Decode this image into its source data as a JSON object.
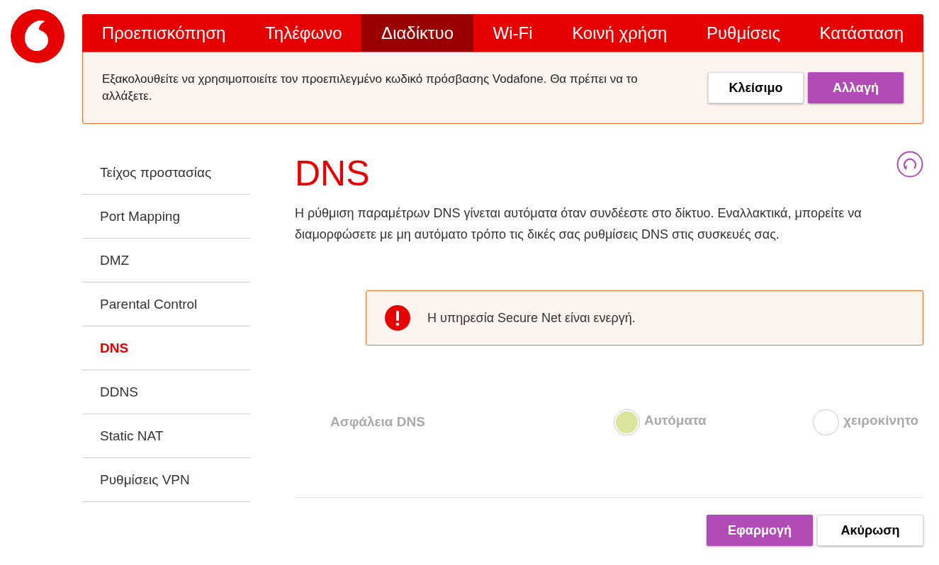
{
  "nav": [
    {
      "label": "Προεπισκόπηση",
      "selected": false
    },
    {
      "label": "Τηλέφωνο",
      "selected": false
    },
    {
      "label": "Διαδίκτυο",
      "selected": true
    },
    {
      "label": "Wi-Fi",
      "selected": false
    },
    {
      "label": "Κοινή χρήση",
      "selected": false
    },
    {
      "label": "Ρυθμίσεις",
      "selected": false
    },
    {
      "label": "Κατάσταση",
      "selected": false
    }
  ],
  "banner": {
    "text": "Εξακολουθείτε να χρησιμοποιείτε τον προεπιλεγμένο κωδικό πρόσβασης Vodafone. Θα πρέπει να το αλλάξετε.",
    "buttons": [
      {
        "label": "Κλείσιμο",
        "kind": "secondary"
      },
      {
        "label": "Αλλαγή",
        "kind": "primary"
      }
    ]
  },
  "sidebar": [
    {
      "label": "Τείχος προστασίας",
      "selected": false
    },
    {
      "label": "Port Mapping",
      "selected": false
    },
    {
      "label": "DMZ",
      "selected": false
    },
    {
      "label": "Parental Control",
      "selected": false
    },
    {
      "label": "DNS",
      "selected": true
    },
    {
      "label": "DDNS",
      "selected": false
    },
    {
      "label": "Static NAT",
      "selected": false
    },
    {
      "label": "Ρυθμίσεις VPN",
      "selected": false
    }
  ],
  "page": {
    "title": "DNS",
    "description": "Η ρύθμιση παραμέτρων DNS γίνεται αυτόματα όταν συνδέεστε στο δίκτυο. Εναλλακτικά, μπορείτε να διαμορφώσετε με μη αυτόματο τρόπο τις δικές σας ρυθμίσεις DNS στις συσκευές σας.",
    "alert": "Η υπηρεσία Secure Net είναι ενεργή.",
    "setting": {
      "label": "Ασφάλεια DNS",
      "disabled": true,
      "options": [
        {
          "label": "Αυτόματα",
          "selected": true
        },
        {
          "label": "χειροκίνητο",
          "selected": false
        }
      ]
    },
    "buttons": [
      {
        "label": "Εφαρμογή",
        "kind": "primary"
      },
      {
        "label": "Ακύρωση",
        "kind": "secondary"
      }
    ]
  }
}
